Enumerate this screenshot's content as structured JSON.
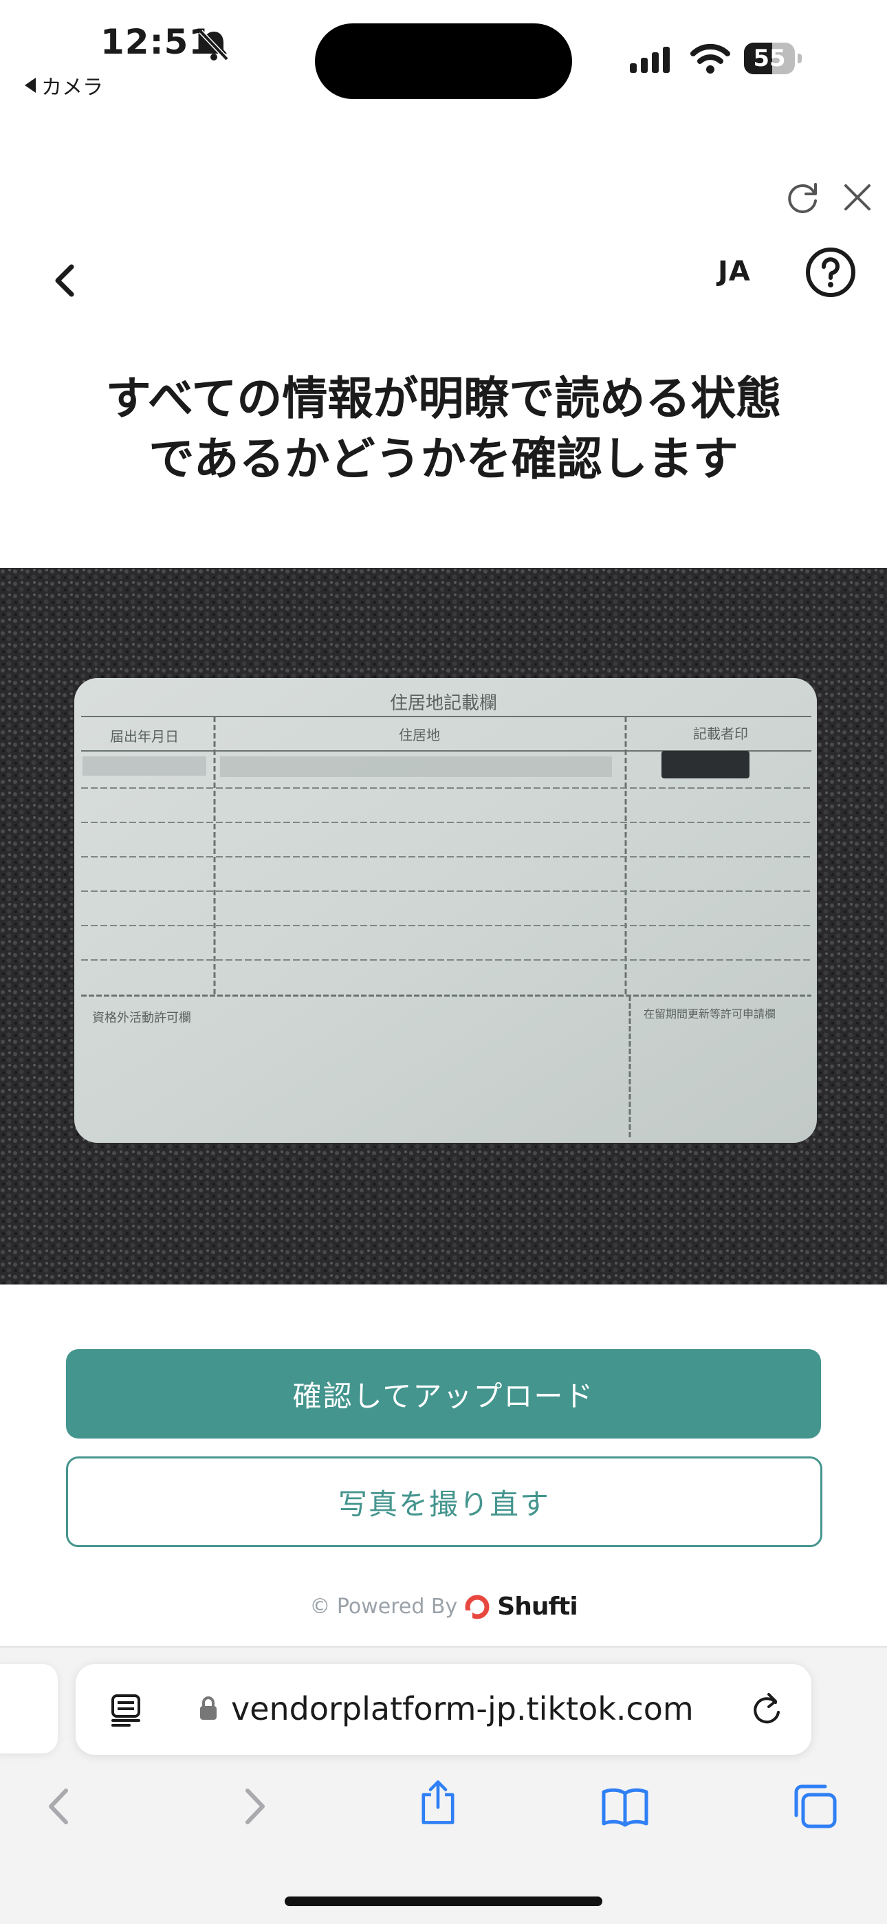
{
  "status_bar": {
    "time": "12:51",
    "back_app_label": "カメラ",
    "battery": "55",
    "battery_level": 0.55,
    "icons": [
      "bell-slash-icon",
      "cellular-signal-icon",
      "wifi-icon",
      "battery-icon"
    ]
  },
  "header": {
    "language": "JA",
    "icons": [
      "refresh-icon",
      "close-icon",
      "back-chevron-icon",
      "help-icon"
    ]
  },
  "title_lines": [
    "すべての情報が明瞭で読める状態",
    "であるかどうかを確認します"
  ],
  "photo": {
    "card_heading": "住居地記載欄",
    "col_date": "届出年月日",
    "col_address": "住居地",
    "col_seal": "記載者印",
    "lower_left": "資格外活動許可欄",
    "lower_right": "在留期間更新等許可申請欄"
  },
  "actions": {
    "confirm_label": "確認してアップロード",
    "retake_label": "写真を撮り直す"
  },
  "footer": {
    "powered_by": "© Powered By",
    "brand": "Shufti"
  },
  "browser": {
    "url": "vendorplatform-jp.tiktok.com",
    "icons": [
      "reader-icon",
      "lock-icon",
      "reload-icon",
      "back-arrow-icon",
      "forward-arrow-icon",
      "share-icon",
      "bookmarks-icon",
      "tabs-icon"
    ]
  },
  "colors": {
    "accent": "#44958e",
    "text": "#1b1b1b",
    "safari_blue": "#2f7ff5"
  }
}
